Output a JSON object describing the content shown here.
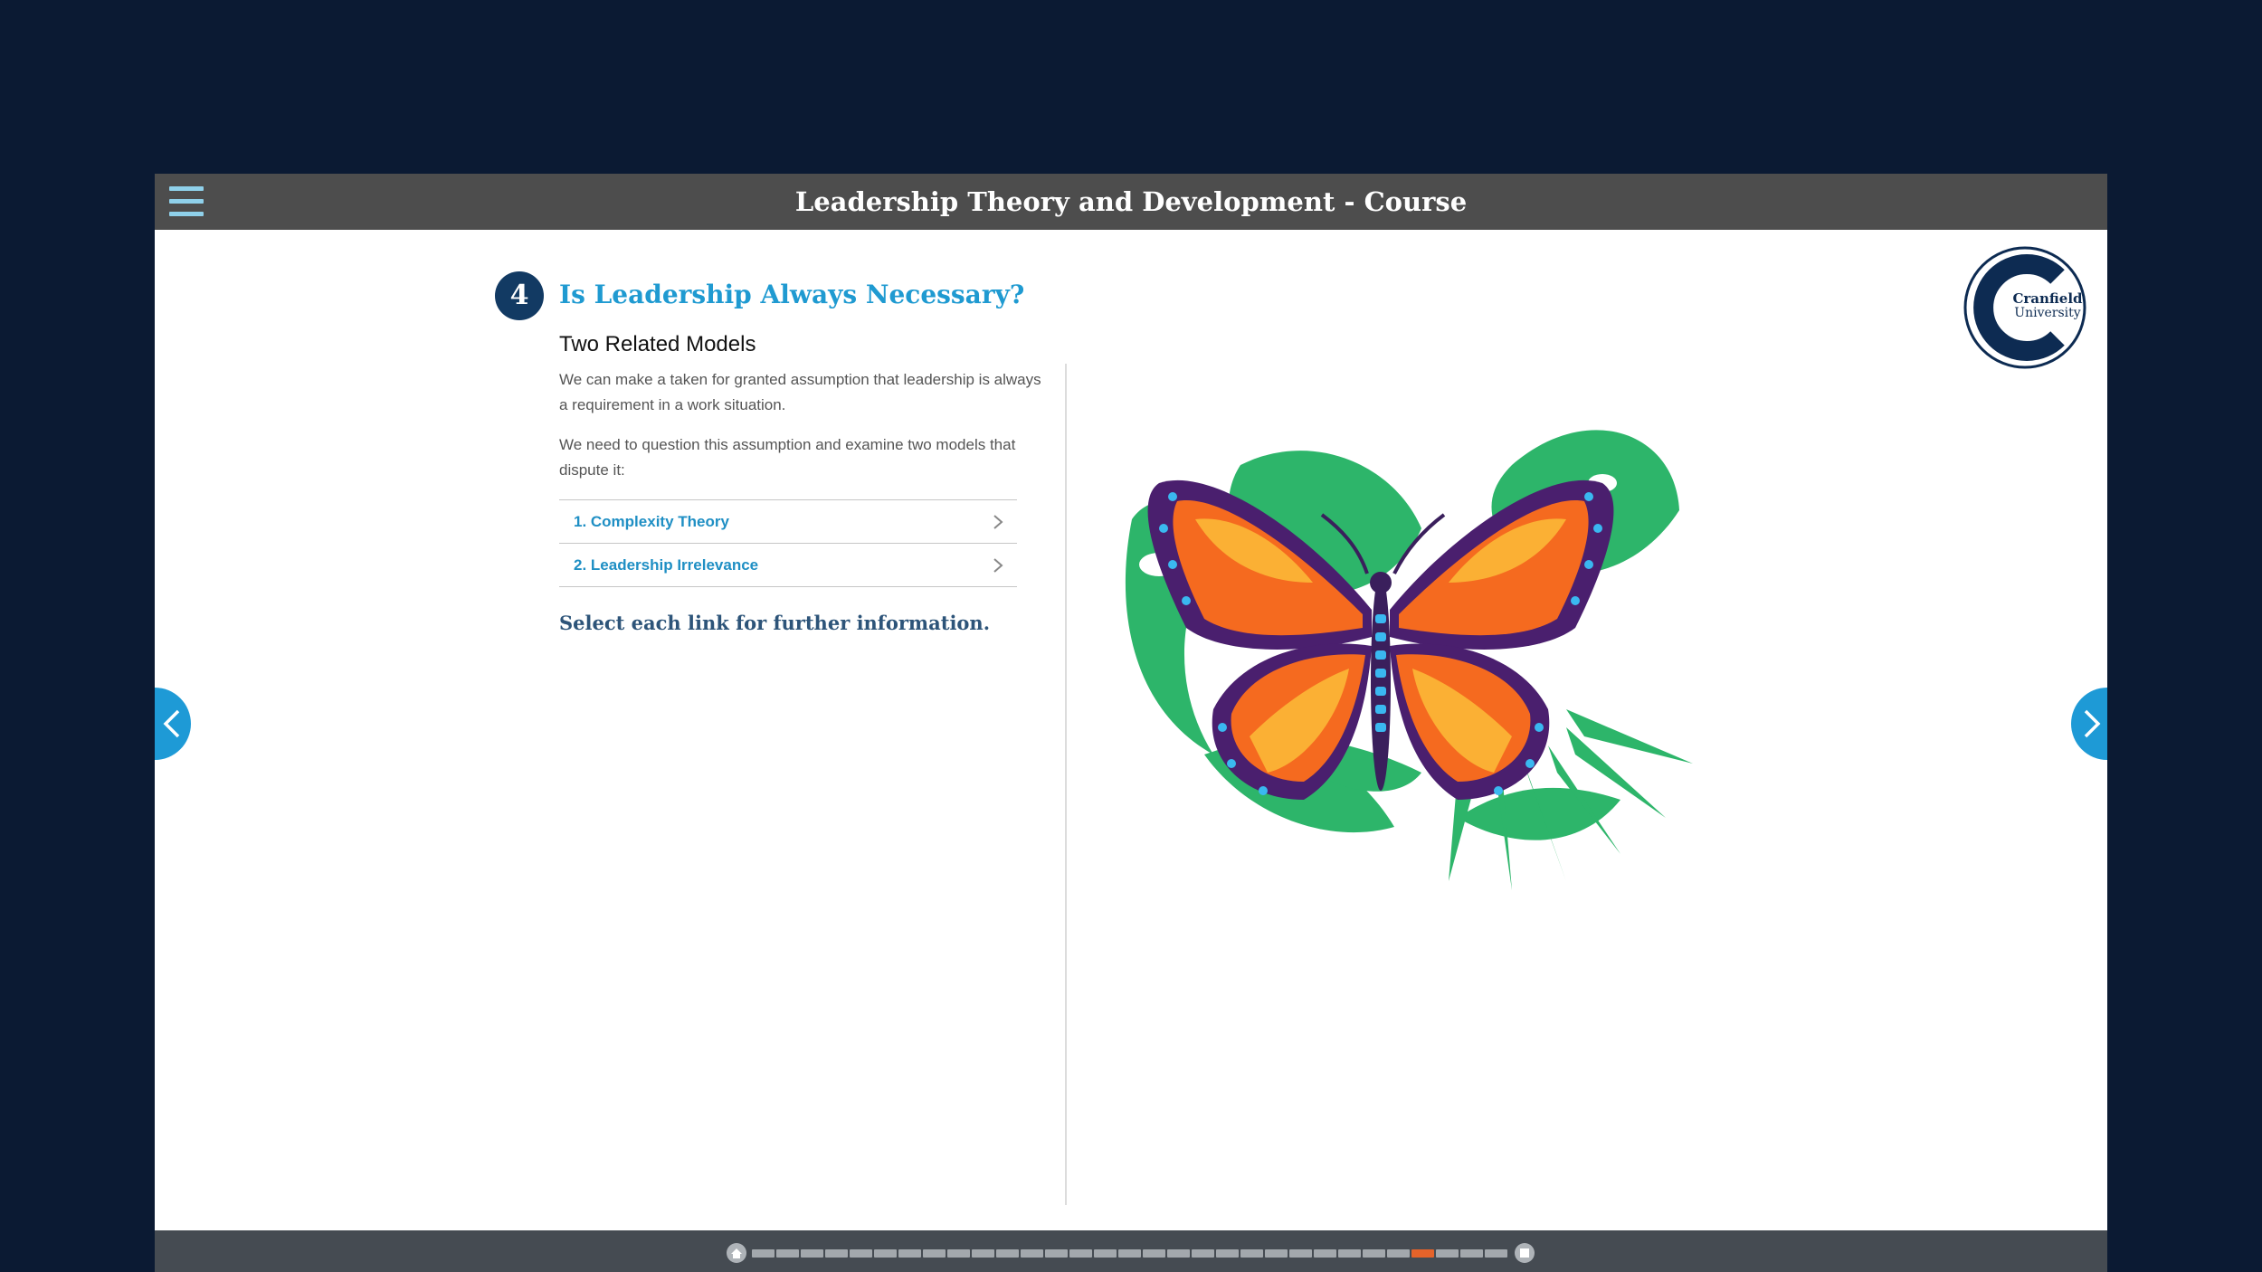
{
  "header": {
    "title": "Leadership Theory and Development - Course",
    "menu_icon": "hamburger-menu-icon",
    "bar_color": "#4d4d4d",
    "menu_icon_color": "#8fd0ea"
  },
  "logo": {
    "line1": "Cranfield",
    "line2": "University",
    "color": "#0d2b52"
  },
  "section": {
    "number": "4",
    "title": "Is Leadership Always Necessary?",
    "subtitle": "Two Related Models",
    "paragraphs": [
      "We can make a taken for granted assumption that leadership is always a requirement in a work situation.",
      "We need to question this assumption and examine two models that dispute it:"
    ],
    "links": [
      {
        "label": "1. Complexity Theory",
        "icon": "chevron-right-icon"
      },
      {
        "label": "2. Leadership Irrelevance",
        "icon": "chevron-right-icon"
      }
    ],
    "instruction": "Select each link for further information.",
    "title_color": "#1f9ad1",
    "badge_color": "#123a63"
  },
  "illustration": {
    "subject": "butterfly-on-tropical-leaves-illustration"
  },
  "navigation": {
    "prev_icon": "chevron-left-icon",
    "next_icon": "chevron-right-icon",
    "arrow_color": "#1e9ad6"
  },
  "progress": {
    "home_icon": "home-icon",
    "end_icon": "menu-end-icon",
    "total_pages": 31,
    "current_page": 28,
    "active_color": "#e5632a",
    "inactive_color": "#a3a8ad"
  }
}
